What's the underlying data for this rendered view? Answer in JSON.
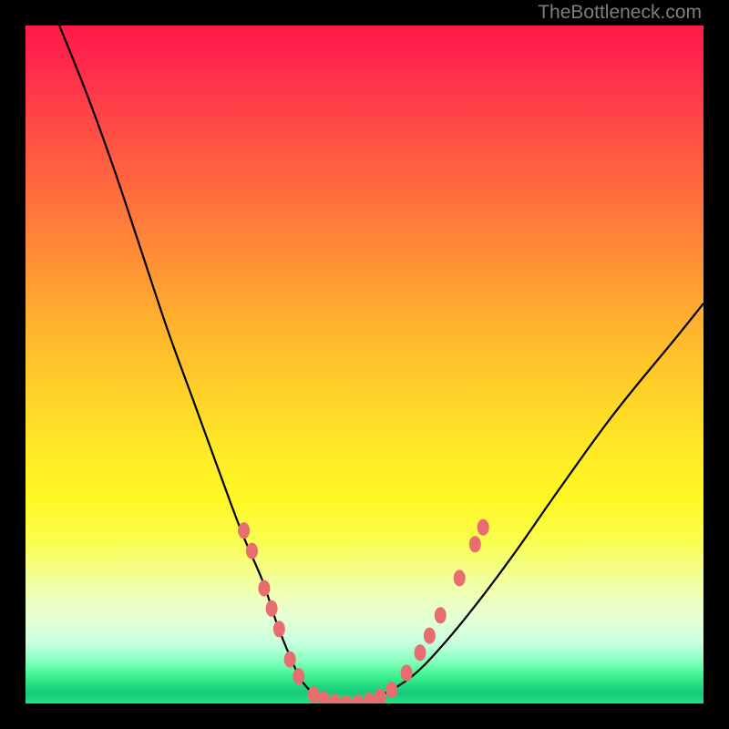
{
  "watermark": "TheBottleneck.com",
  "colors": {
    "bg": "#000000",
    "curve": "#000000",
    "dot_fill": "#e86d6f",
    "dot_stroke": "#c94a4d",
    "gradient_top": "#ff1a48",
    "gradient_bottom": "#20e486"
  },
  "chart_data": {
    "type": "line",
    "title": "",
    "xlabel": "",
    "ylabel": "",
    "xlim": [
      0,
      100
    ],
    "ylim": [
      0,
      100
    ],
    "grid": false,
    "legend": false,
    "notes": "Bottleneck-style V curve. x is relative GPU/CPU balance (0–100), y is bottleneck % (0 = perfect match at valley). No axis ticks shown; values estimated from shape.",
    "series": [
      {
        "name": "curve",
        "x": [
          5,
          9,
          13,
          17,
          21,
          25,
          29,
          32,
          35,
          37,
          39,
          41,
          44,
          47,
          50,
          53,
          57,
          61,
          66,
          72,
          79,
          87,
          96,
          100
        ],
        "y": [
          100,
          90,
          79,
          67,
          55,
          44,
          33,
          25,
          18,
          12,
          7,
          3,
          0.5,
          0,
          0.3,
          1.5,
          4,
          8,
          14,
          22,
          32,
          43,
          54,
          59
        ]
      }
    ],
    "highlight_dots": [
      {
        "x": 32.2,
        "y": 25.5
      },
      {
        "x": 33.4,
        "y": 22.5
      },
      {
        "x": 35.2,
        "y": 17.0
      },
      {
        "x": 36.3,
        "y": 14.0
      },
      {
        "x": 37.4,
        "y": 11.0
      },
      {
        "x": 39.0,
        "y": 6.5
      },
      {
        "x": 40.3,
        "y": 4.0
      },
      {
        "x": 42.5,
        "y": 1.3
      },
      {
        "x": 44.0,
        "y": 0.6
      },
      {
        "x": 45.7,
        "y": 0.2
      },
      {
        "x": 47.3,
        "y": 0.0
      },
      {
        "x": 49.0,
        "y": 0.1
      },
      {
        "x": 50.7,
        "y": 0.4
      },
      {
        "x": 52.3,
        "y": 1.0
      },
      {
        "x": 54.0,
        "y": 2.0
      },
      {
        "x": 56.2,
        "y": 4.5
      },
      {
        "x": 58.2,
        "y": 7.5
      },
      {
        "x": 59.6,
        "y": 10.0
      },
      {
        "x": 61.2,
        "y": 13.0
      },
      {
        "x": 64.0,
        "y": 18.5
      },
      {
        "x": 66.3,
        "y": 23.5
      },
      {
        "x": 67.5,
        "y": 26.0
      }
    ]
  }
}
